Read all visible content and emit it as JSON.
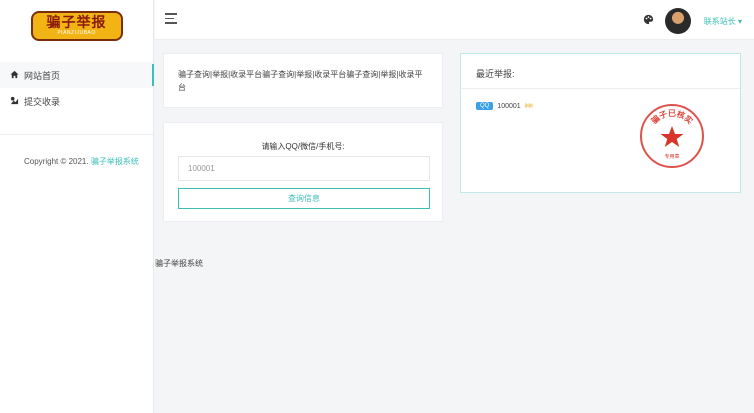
{
  "logo": {
    "title": "骗子举报",
    "subtitle": "PIANZIJUBAO"
  },
  "sidebar": {
    "items": [
      {
        "label": "网站首页",
        "icon": "home-icon"
      },
      {
        "label": "提交收录",
        "icon": "submit-icon"
      }
    ],
    "copyright_text": "Copyright © 2021. ",
    "copyright_link": "骗子举报系统"
  },
  "header": {
    "user_label": "联系站长 ▾"
  },
  "desc_card": {
    "text": "骗子查询|举报|收录平台骗子查询|举报|收录平台骗子查询|举报|收录平台"
  },
  "query_card": {
    "label": "请输入QQ/微信/手机号:",
    "input_value": "100001",
    "button_label": "查询信息"
  },
  "recent_card": {
    "title": "最近举报:",
    "item_tag": "QQ",
    "item_number": "100001",
    "item_time": "刚刚",
    "stamp_text": "骗子已核实",
    "stamp_sub": "专用章",
    "stamp_color": "#d9352b"
  },
  "footer": {
    "text": "骗子举报系统"
  },
  "colors": {
    "accent": "#3bbfb8",
    "qq_blue": "#3aa0e8"
  }
}
